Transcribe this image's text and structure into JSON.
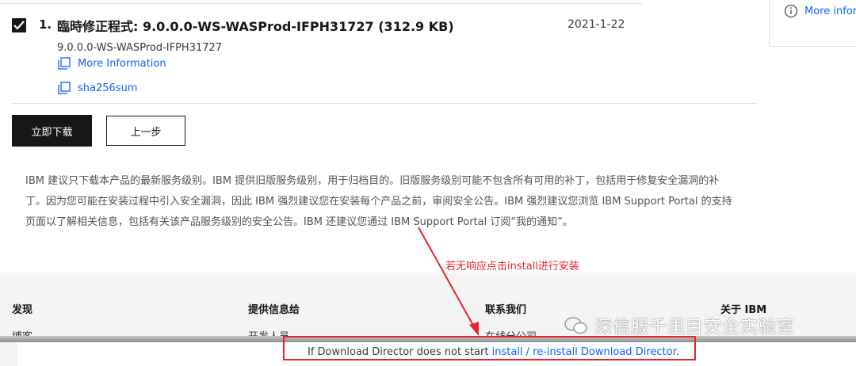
{
  "fix": {
    "index": "1.",
    "title": "臨時修正程式: 9.0.0.0-WS-WASProd-IFPH31727 (312.9 KB)",
    "date": "2021-1-22",
    "subtitle": "9.0.0.0-WS-WASProd-IFPH31727",
    "more_info": "More Information",
    "sha": "sha256sum"
  },
  "buttons": {
    "download_now": "立即下载",
    "previous": "上一步"
  },
  "notice": "IBM 建议只下载本产品的最新服务级别。IBM 提供旧版服务级别，用于归档目的。旧版服务级别可能不包含所有可用的补丁，包括用于修复安全漏洞的补丁。因为您可能在安装过程中引入安全漏洞，因此 IBM 强烈建议您在安装每个产品之前，审阅安全公告。IBM 强烈建议您浏览 IBM Support Portal 的支持页面以了解相关信息，包括有关该产品服务级别的安全公告。IBM 还建议您通过 IBM Support Portal 订阅“我的通知”。",
  "right_panel": {
    "more_info": "More inforr"
  },
  "footer": {
    "columns": [
      {
        "heading": "发现",
        "link": "博客"
      },
      {
        "heading": "提供信息给",
        "link": "开发人员"
      },
      {
        "heading": "联系我们",
        "link": "在线分公司"
      },
      {
        "heading": "关于 IBM",
        "link": ""
      }
    ]
  },
  "annotation": {
    "text": "若无响应点击install进行安装",
    "color": "#e8242b"
  },
  "watermark": "深信服千里目安全实验室",
  "download_director": {
    "prefix": "If Download Director does not start ",
    "link": "install / re-install Download Director",
    "suffix": "."
  },
  "colors": {
    "link": "#0f62fe",
    "primary_button": "#161616",
    "annotation_red": "#e8242b",
    "footer_bg": "#f4f4f4"
  }
}
